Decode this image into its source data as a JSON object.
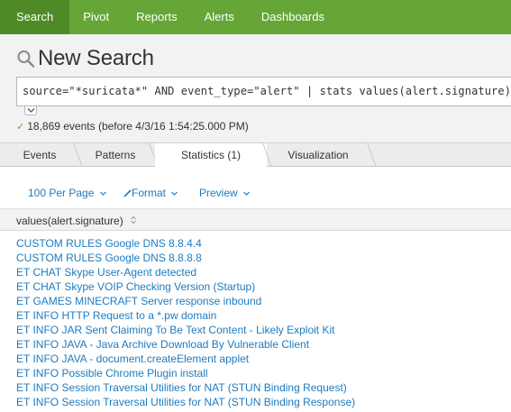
{
  "nav": {
    "items": [
      {
        "label": "Search",
        "active": true
      },
      {
        "label": "Pivot"
      },
      {
        "label": "Reports"
      },
      {
        "label": "Alerts"
      },
      {
        "label": "Dashboards"
      }
    ]
  },
  "header": {
    "title": "New Search",
    "query": "source=\"*suricata*\" AND event_type=\"alert\" | stats values(alert.signature)",
    "status": "18,869 events (before 4/3/16 1:54:25.000 PM)"
  },
  "tabs": [
    {
      "label": "Events"
    },
    {
      "label": "Patterns"
    },
    {
      "label": "Statistics (1)",
      "active": true
    },
    {
      "label": "Visualization"
    }
  ],
  "toolbar": {
    "per_page": "100 Per Page",
    "format": "Format",
    "preview": "Preview"
  },
  "table": {
    "column": "values(alert.signature)",
    "rows": [
      "CUSTOM RULES Google DNS 8.8.4.4",
      "CUSTOM RULES Google DNS 8.8.8.8",
      "ET CHAT Skype User-Agent detected",
      "ET CHAT Skype VOIP Checking Version (Startup)",
      "ET GAMES MINECRAFT Server response inbound",
      "ET INFO HTTP Request to a *.pw domain",
      "ET INFO JAR Sent Claiming To Be Text Content - Likely Exploit Kit",
      "ET INFO JAVA - Java Archive Download By Vulnerable Client",
      "ET INFO JAVA - document.createElement applet",
      "ET INFO Possible Chrome Plugin install",
      "ET INFO Session Traversal Utilities for NAT (STUN Binding Request)",
      "ET INFO Session Traversal Utilities for NAT (STUN Binding Response)"
    ]
  },
  "colors": {
    "nav_bg": "#65a637",
    "nav_active": "#4e8b26",
    "link": "#1e7bbf"
  }
}
